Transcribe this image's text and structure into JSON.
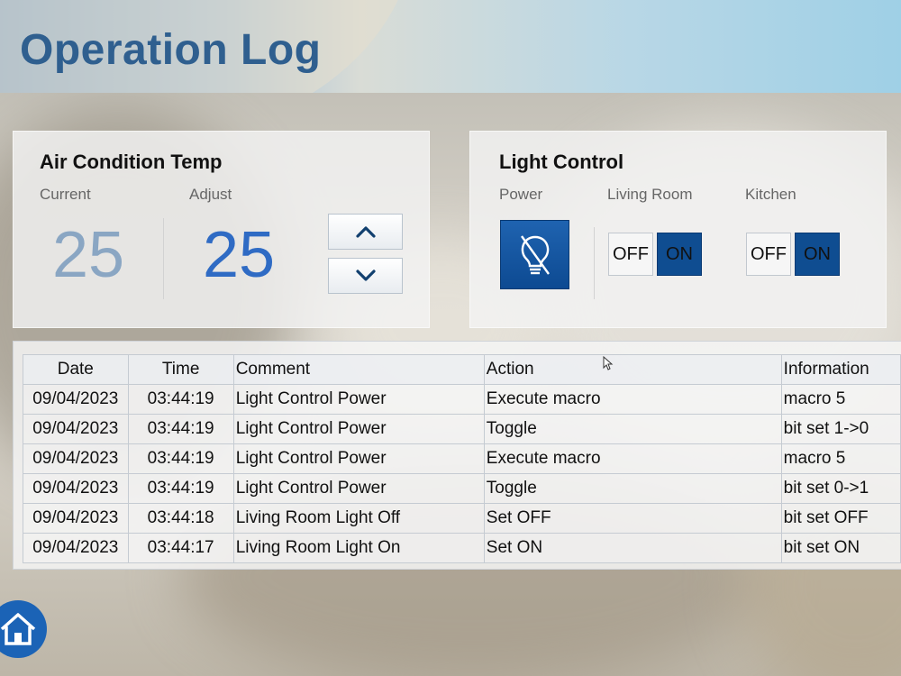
{
  "header": {
    "title": "Operation Log"
  },
  "air_condition": {
    "title": "Air Condition Temp",
    "current_label": "Current",
    "current_value": "25",
    "adjust_label": "Adjust",
    "adjust_value": "25",
    "up_icon": "chevron-up-icon",
    "down_icon": "chevron-down-icon"
  },
  "light_control": {
    "title": "Light Control",
    "power_label": "Power",
    "power_icon": "lightbulb-off-icon",
    "living_room_label": "Living Room",
    "living_room": {
      "off_label": "OFF",
      "on_label": "ON"
    },
    "kitchen_label": "Kitchen",
    "kitchen": {
      "off_label": "OFF",
      "on_label": "ON"
    }
  },
  "log": {
    "columns": [
      "Date",
      "Time",
      "Comment",
      "Action",
      "Information"
    ],
    "rows": [
      [
        "09/04/2023",
        "03:44:19",
        "Light Control Power",
        "Execute macro",
        "macro 5"
      ],
      [
        "09/04/2023",
        "03:44:19",
        "Light Control Power",
        "Toggle",
        "bit set 1->0"
      ],
      [
        "09/04/2023",
        "03:44:19",
        "Light Control Power",
        "Execute macro",
        "macro 5"
      ],
      [
        "09/04/2023",
        "03:44:19",
        "Light Control Power",
        "Toggle",
        "bit set 0->1"
      ],
      [
        "09/04/2023",
        "03:44:18",
        "Living Room Light Off",
        "Set OFF",
        "bit set OFF"
      ],
      [
        "09/04/2023",
        "03:44:17",
        "Living Room Light On",
        "Set ON",
        "bit set ON"
      ]
    ]
  },
  "nav": {
    "home_icon": "home-icon"
  },
  "colors": {
    "accent": "#0f4d91",
    "title": "#2f5f8f",
    "adjust": "#2f6bc4",
    "current": "#8aa6c3"
  }
}
